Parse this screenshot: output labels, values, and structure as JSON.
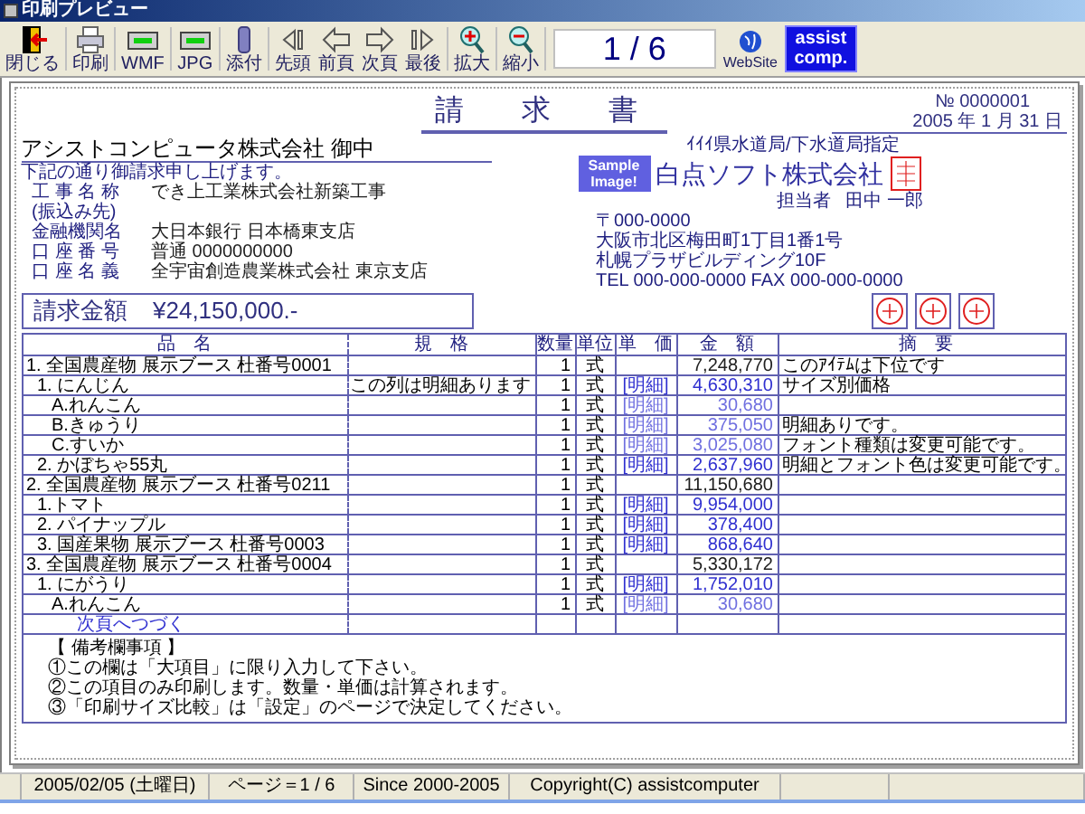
{
  "window": {
    "title": "印刷プレビュー"
  },
  "toolbar": {
    "buttons": [
      {
        "label": "閉じる",
        "kind": "exit"
      },
      {
        "label": "印刷",
        "kind": "printer"
      },
      {
        "label": "WMF",
        "kind": "screen"
      },
      {
        "label": "JPG",
        "kind": "screen"
      },
      {
        "label": "添付",
        "kind": "clip"
      },
      {
        "label": "先頭",
        "kind": "first"
      },
      {
        "label": "前頁",
        "kind": "prev"
      },
      {
        "label": "次頁",
        "kind": "next"
      },
      {
        "label": "最後",
        "kind": "last"
      },
      {
        "label": "拡大",
        "kind": "zoom_in"
      },
      {
        "label": "縮小",
        "kind": "zoom_out"
      }
    ],
    "page_display": "1 / 6",
    "website": "WebSite",
    "logo": [
      "assist",
      "comp."
    ]
  },
  "document": {
    "title": "請　求　書",
    "number": "№ 0000001",
    "date": "2005 年 1 月 31 日",
    "recipient": "アシストコンピュータ株式会社 御中",
    "greeting": "下記の通り御請求申し上げます。",
    "fields": [
      {
        "label": "工 事 名 称",
        "value": "でき上工業株式会社新築工事"
      },
      {
        "label": "(振込み先)"
      },
      {
        "label": "金融機関名",
        "value": "大日本銀行 日本橋東支店"
      },
      {
        "label": "口 座 番 号",
        "value": "普通 0000000000"
      },
      {
        "label": "口 座 名 義",
        "value": "全宇宙創造農業株式会社 東京支店"
      }
    ],
    "sender": {
      "note": "ｲｲｲ県水道局/下水道局指定",
      "sample": [
        "Sample",
        "Image!"
      ],
      "company": "白点ソフト株式会社",
      "contact_label": "担当者",
      "contact": "田中 一郎",
      "lines": [
        "〒000-0000",
        "大阪市北区梅田町1丁目1番1号",
        "札幌プラザビルディング10F",
        "TEL 000-000-0000 FAX 000-000-0000"
      ]
    },
    "total": {
      "label": "請求金額",
      "value": "¥24,150,000.-"
    },
    "table": {
      "columns": [
        "品　名",
        "規　格",
        "数量",
        "単位",
        "単　価",
        "金　額",
        "摘　要"
      ],
      "rows": [
        {
          "name": "1. 全国農産物 展示ブース 杜番号0001",
          "qty": "1",
          "unit": "式",
          "amount": "7,248,770",
          "memo": "このｱｲﾃﾑは下位です",
          "children": [
            {
              "name": "1. にんじん",
              "spec": "この列は明細あります",
              "qty": "1",
              "unit": "式",
              "detail": "[明細]",
              "amount": "4,630,310",
              "memo": "サイズ別価格",
              "children": [
                {
                  "name": "A.れんこん",
                  "qty": "1",
                  "unit": "式",
                  "detail": "[明細]",
                  "amount": "30,680"
                },
                {
                  "name": "B.きゅうり",
                  "qty": "1",
                  "unit": "式",
                  "detail": "[明細]",
                  "amount": "375,050",
                  "memo": "明細ありです。"
                },
                {
                  "name": "C.すいか",
                  "qty": "1",
                  "unit": "式",
                  "detail": "[明細]",
                  "amount": "3,025,080",
                  "memo": "フォント種類は変更可能です。"
                }
              ]
            },
            {
              "name": "2. かぼちゃ55丸",
              "qty": "1",
              "unit": "式",
              "detail": "[明細]",
              "amount": "2,637,960",
              "memo": "明細とフォント色は変更可能です。"
            }
          ]
        },
        {
          "name": "2. 全国農産物 展示ブース 杜番号0211",
          "qty": "1",
          "unit": "式",
          "amount": "11,150,680",
          "children": [
            {
              "name": "1.トマト",
              "qty": "1",
              "unit": "式",
              "detail": "[明細]",
              "amount": "9,954,000"
            },
            {
              "name": "2. パイナップル",
              "qty": "1",
              "unit": "式",
              "detail": "[明細]",
              "amount": "378,400"
            },
            {
              "name": "3. 国産果物 展示ブース 杜番号0003",
              "qty": "1",
              "unit": "式",
              "detail": "[明細]",
              "amount": "868,640"
            }
          ]
        },
        {
          "name": "3. 全国農産物 展示ブース 杜番号0004",
          "qty": "1",
          "unit": "式",
          "amount": "5,330,172",
          "children": [
            {
              "name": "1. にがうり",
              "qty": "1",
              "unit": "式",
              "detail": "[明細]",
              "amount": "1,752,010",
              "children": [
                {
                  "name": "A.れんこん",
                  "qty": "1",
                  "unit": "式",
                  "detail": "[明細]",
                  "amount": "30,680"
                }
              ]
            }
          ]
        }
      ],
      "continued": "次頁へつづく"
    },
    "notes": {
      "heading": "【 備考欄事項 】",
      "lines": [
        "①この欄は「大項目」に限り入力して下さい。",
        "②この項目のみ印刷します。数量・単価は計算されます。",
        "③「印刷サイズ比較」は「設定」のページで決定してください。"
      ]
    }
  },
  "status_bar": [
    {
      "text": "2005/02/05 (土曜日)"
    },
    {
      "text": "ページ＝1 / 6"
    },
    {
      "text": "Since 2000-2005"
    },
    {
      "text": "Copyright(C) assistcomputer"
    }
  ]
}
